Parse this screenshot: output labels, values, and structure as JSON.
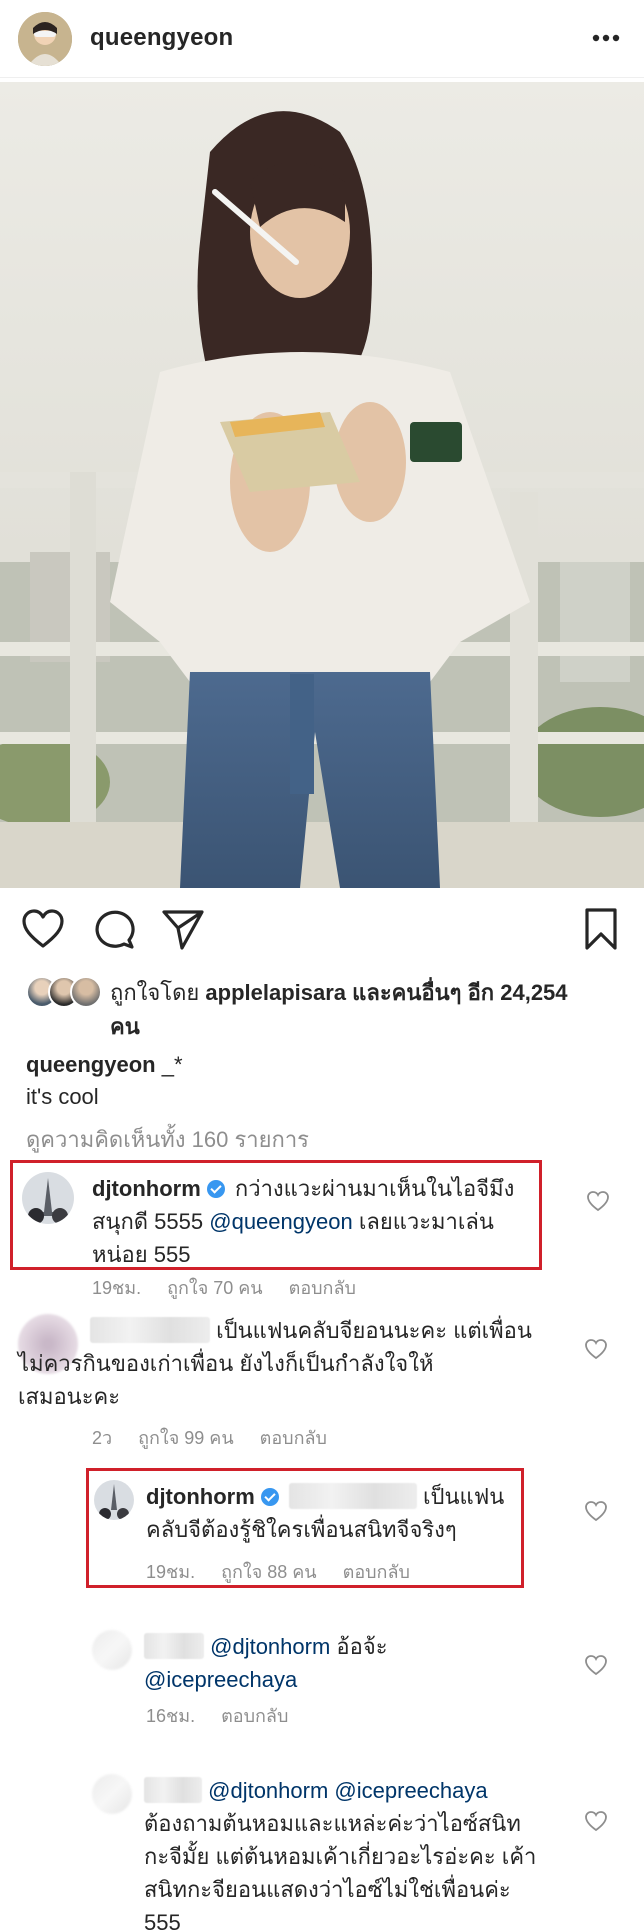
{
  "header": {
    "username": "queengyeon",
    "more_icon": "more-horizontal-icon"
  },
  "photo": {
    "description_icon": "post-photo"
  },
  "actions": {
    "like_icon": "heart-icon",
    "comment_icon": "comment-icon",
    "share_icon": "paper-plane-icon",
    "save_icon": "bookmark-icon"
  },
  "likes": {
    "prefix": "ถูกใจโดย",
    "liker": "applelapisara",
    "suffix": "และคนอื่นๆ อีก 24,254",
    "suffix_line2": "คน"
  },
  "caption": {
    "username": "queengyeon",
    "text_inline": "_*",
    "text": "it's cool"
  },
  "view_all_comments": "ดูความคิดเห็นทั้ง 160 รายการ",
  "comments": [
    {
      "username": "djtonhorm",
      "verified": true,
      "line1": "กว่างแวะผ่านมาเห็นในไอจีมึง",
      "line2_a": "สนุกดี 5555 ",
      "mention": "@queengyeon",
      "line2_b": " เลยแวะมาเล่น",
      "line3": "หน่อย 555",
      "time": "19ชม.",
      "likes": "ถูกใจ 70 คน",
      "reply": "ตอบกลับ"
    },
    {
      "username": "",
      "verified": false,
      "line1": "เป็นแฟนคลับจียอนนะคะ แต่เพื่อน",
      "line2": "ไม่ควรกินของเก่าเพื่อน ยังไงก็เป็นกำลังใจให้",
      "line3": "เสมอนะคะ",
      "time": "2ว",
      "likes": "ถูกใจ 99 คน",
      "reply": "ตอบกลับ"
    },
    {
      "username": "djtonhorm",
      "verified": true,
      "line1": "เป็นแฟน",
      "line2": "คลับจีต้องรู้ชิใครเพื่อนสนิทจีจริงๆ",
      "time": "19ชม.",
      "likes": "ถูกใจ 88 คน",
      "reply": "ตอบกลับ"
    },
    {
      "username": "",
      "mention1": "@djtonhorm",
      "text1": " อ้อจ้ะ",
      "mention2": "@icepreechaya",
      "time": "16ชม.",
      "reply": "ตอบกลับ"
    },
    {
      "username": "",
      "mention1": "@djtonhorm",
      "mention2": "@icepreechaya",
      "line2": "ต้องถามต้นหอมและแหล่ะค่ะว่าไอซ์สนิท",
      "line3": "กะจีมั้ย แต่ต้นหอมเค้าเกี่ยวอะไรอ่ะคะ เค้า",
      "line4": "สนิทกะจียอนแสดงว่าไอซ์ไม่ใช่เพื่อนค่ะ",
      "line5": "555"
    }
  ],
  "colors": {
    "text": "#262626",
    "muted": "#8e8e8e",
    "mention": "#003569",
    "verified": "#3897f0",
    "highlight_box": "#d0202a"
  }
}
